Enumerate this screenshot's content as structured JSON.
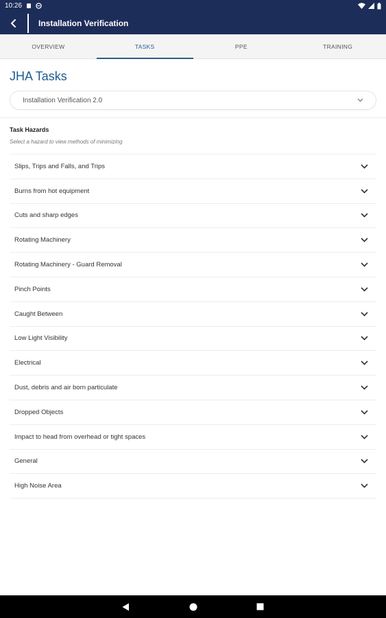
{
  "status_bar": {
    "time": "10:26",
    "icons": [
      "notification-icon",
      "sync-icon",
      "wifi-icon",
      "signal-icon",
      "battery-icon"
    ]
  },
  "app_bar": {
    "title": "Installation Verification",
    "back_icon": "back-icon"
  },
  "tabs": [
    {
      "label": "OVERVIEW",
      "active": false
    },
    {
      "label": "TASKS",
      "active": true
    },
    {
      "label": "PPE",
      "active": false
    },
    {
      "label": "TRAINING",
      "active": false
    }
  ],
  "main": {
    "title": "JHA Tasks",
    "task_select": {
      "value": "Installation Verification 2.0"
    },
    "hazards_title": "Task Hazards",
    "hazards_subtitle": "Select a hazard to view methods of minimizing",
    "hazards": [
      {
        "label": "Slips, Trips and Falls, and Trips"
      },
      {
        "label": "Burns from hot equipment"
      },
      {
        "label": "Cuts and sharp edges"
      },
      {
        "label": "Rotating Machinery"
      },
      {
        "label": "Rotating Machinery - Guard Removal"
      },
      {
        "label": "Pinch Points"
      },
      {
        "label": "Caught Between"
      },
      {
        "label": "Low Light Visibility"
      },
      {
        "label": "Electrical"
      },
      {
        "label": "Dust, debris and air born particulate"
      },
      {
        "label": "Dropped Objects"
      },
      {
        "label": "Impact to head from overhead or tight spaces"
      },
      {
        "label": "General"
      },
      {
        "label": "High Noise Area"
      }
    ]
  },
  "nav_bar": {
    "icons": [
      "nav-back-icon",
      "nav-home-icon",
      "nav-recents-icon"
    ]
  },
  "colors": {
    "header": "#1d2d5a",
    "accent": "#1f5c91",
    "tab_active": "#2b5d8a"
  }
}
